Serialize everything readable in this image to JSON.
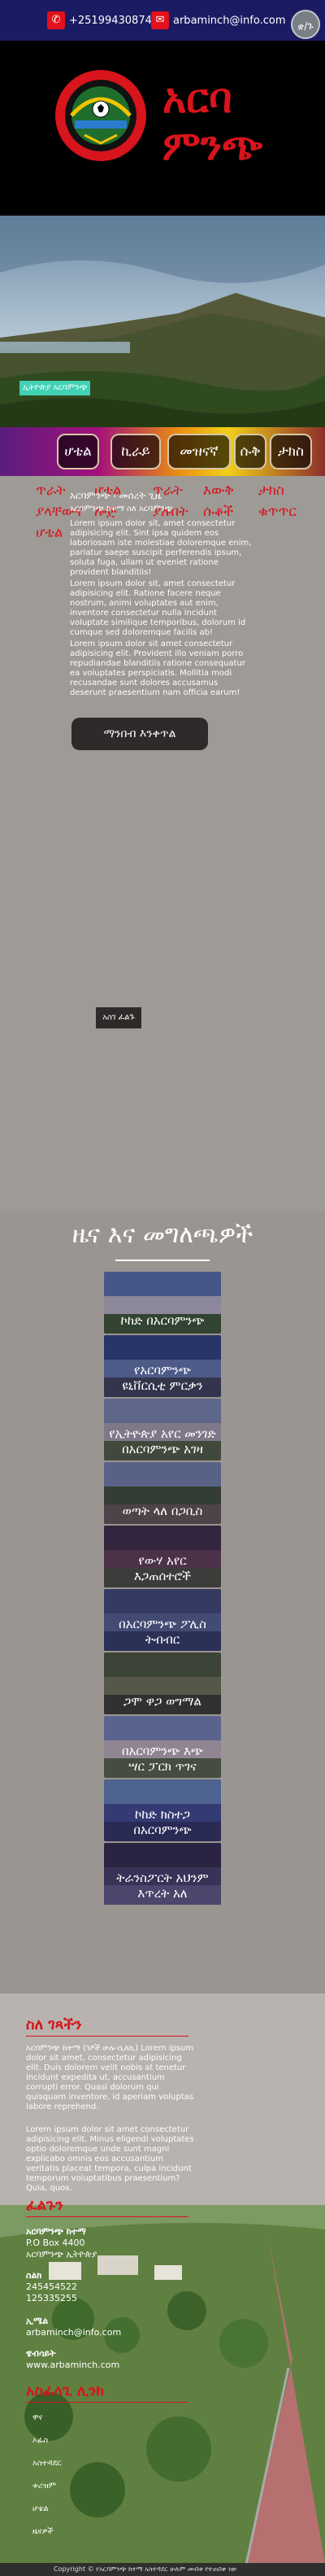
{
  "topbar": {
    "phone": "+251994308743",
    "email": "arbaminch@info.com",
    "lang_button": "ቋ/ጉ",
    "colors": {
      "bar": "#1b1b63",
      "icon": "#e2111b"
    }
  },
  "logo": {
    "line1": "አርባ",
    "line2": "ምንጭ",
    "color": "#d8141c"
  },
  "hero": {
    "tag": "ኢትዮጵያ አርባምንጭ"
  },
  "menu": {
    "items": [
      "ሆቴል",
      "ኪራይ",
      "መዝናኛ",
      "ሱቅ",
      "ታክስ"
    ],
    "sub_col1": [
      "ጥራት",
      "ያላቸውና",
      "ሆቴል"
    ],
    "sub_col2": [
      "ሆቴል",
      "ሎጅ"
    ],
    "sub_col3": [
      "ጥራት",
      "ያሉበት"
    ],
    "sub_col4": [
      "እውቅ",
      "ሱቆች"
    ],
    "sub_col5": [
      "ታክስ",
      "ቁጥጥር"
    ]
  },
  "about": {
    "title": "አርባምንጭ ፡ መሰረት ጊዜ",
    "subtitle": "አርባምንጭ ከተማ ስለ አርባምንጭ",
    "p1": "Lorem ipsum dolor sit, amet consectetur adipisicing elit. Sint ipsa quidem eos laboriosam iste molestiae doloremque enim, pariatur saepe suscipit perferendis ipsum, soluta fuga, ullam ut eveniet ratione provident blanditiis!",
    "p2": "Lorem ipsum dolor sit, amet consectetur adipisicing elit. Ratione facere neque nostrum, animi voluptates aut enim, inventore consectetur nulla incidunt voluptate similique temporibus, dolorum id cumque sed doloremque facilis ab!",
    "p3": "Lorem ipsum dolor sit amet consectetur adipisicing elit. Provident illo veniam porro repudiandae blanditiis ratione consequatur ea voluptates perspiciatis. Mollitia modi recusandae sunt dolores accusamus deserunt praesentium nam officia earum!",
    "more_button": "ማንበብ እንቀጥል",
    "small_button": "አስገ ፈልጉ"
  },
  "news": {
    "title": "ዜና እና መግለጫዎች",
    "items": [
      {
        "line1": "ኮከድ በአርባምንጭ",
        "line2": ""
      },
      {
        "line1": "የአርባምንጭ",
        "line2": "ዩኒቨርሲቲ ምርቃን"
      },
      {
        "line1": "የኢትዮጵያ አየር መንገድ",
        "line2": "በአርባምንጭ አገዛ"
      },
      {
        "line1": "ወጣት ላለ በጋቢስ",
        "line2": ""
      },
      {
        "line1": "የውሃ አየር",
        "line2": "እጋጠሰተሮች"
      },
      {
        "line1": "በአርባምንጭ ፖሊስ",
        "line2": "ትብብር"
      },
      {
        "line1": "ጋሞ ዋጋ ወግማል",
        "line2": ""
      },
      {
        "line1": "በአርባምንጭ እጭ",
        "line2": "ሣር ፓርክ ጥገና"
      },
      {
        "line1": "ኮከድ ክስተጋ",
        "line2": "በአርባምንጭ"
      },
      {
        "line1": "ትራንስፖርት አህንም",
        "line2": "እጥረት አለ"
      }
    ]
  },
  "footer": {
    "about_heading": "ስለ ገጻችን",
    "about_p1": "አርባምንጭ ከተማ (ገፆች ሁሉ-ሲለኪ) Lorem ipsum dolor sit amet, consectetur adipisicing elit. Duis dolorem velit nobis at tenetur incidunt expedita ut, accusantium corrupti error. Quasi dolorum qui quisquam inventore, id aperiam voluptas labore reprehend.",
    "about_p2": "Lorem ipsum dolor sit amet consectetur adipisicing elit. Minus eligendi voluptates optio doloremque unde sunt magni explicabo omnis eos accusantium veritatis placeat tempora, culpa incidunt temporum voluptatibus praesentium? Quia, quos.",
    "contact_heading": "ፈልጉን",
    "addr_label": "አርባምንጭ ከተማ",
    "addr_val1": "P.O Box 4400",
    "addr_val2": "አርባምንጭ ኢትዮጵያ",
    "phone_label": "ስልክ",
    "phone_val1": "245454522",
    "phone_val2": "125335255",
    "email_label": "ኢሜል",
    "email_val": "arbaminch@info.com",
    "web_label": "ዌብሳይት",
    "web_val": "www.arbaminch.com",
    "links_heading": "አስፈላጊ ሊንክ",
    "links": [
      "ዋና",
      "ኦፊስ",
      "አስተዳደር",
      "ቱሪዝም",
      "ሆቴል",
      "ዜናዎች"
    ],
    "copyright": "Copyright © የአርባምንጭ ከተማ አስተዳደር ሁሉም መብቱ የተጠበቀ ነው"
  }
}
